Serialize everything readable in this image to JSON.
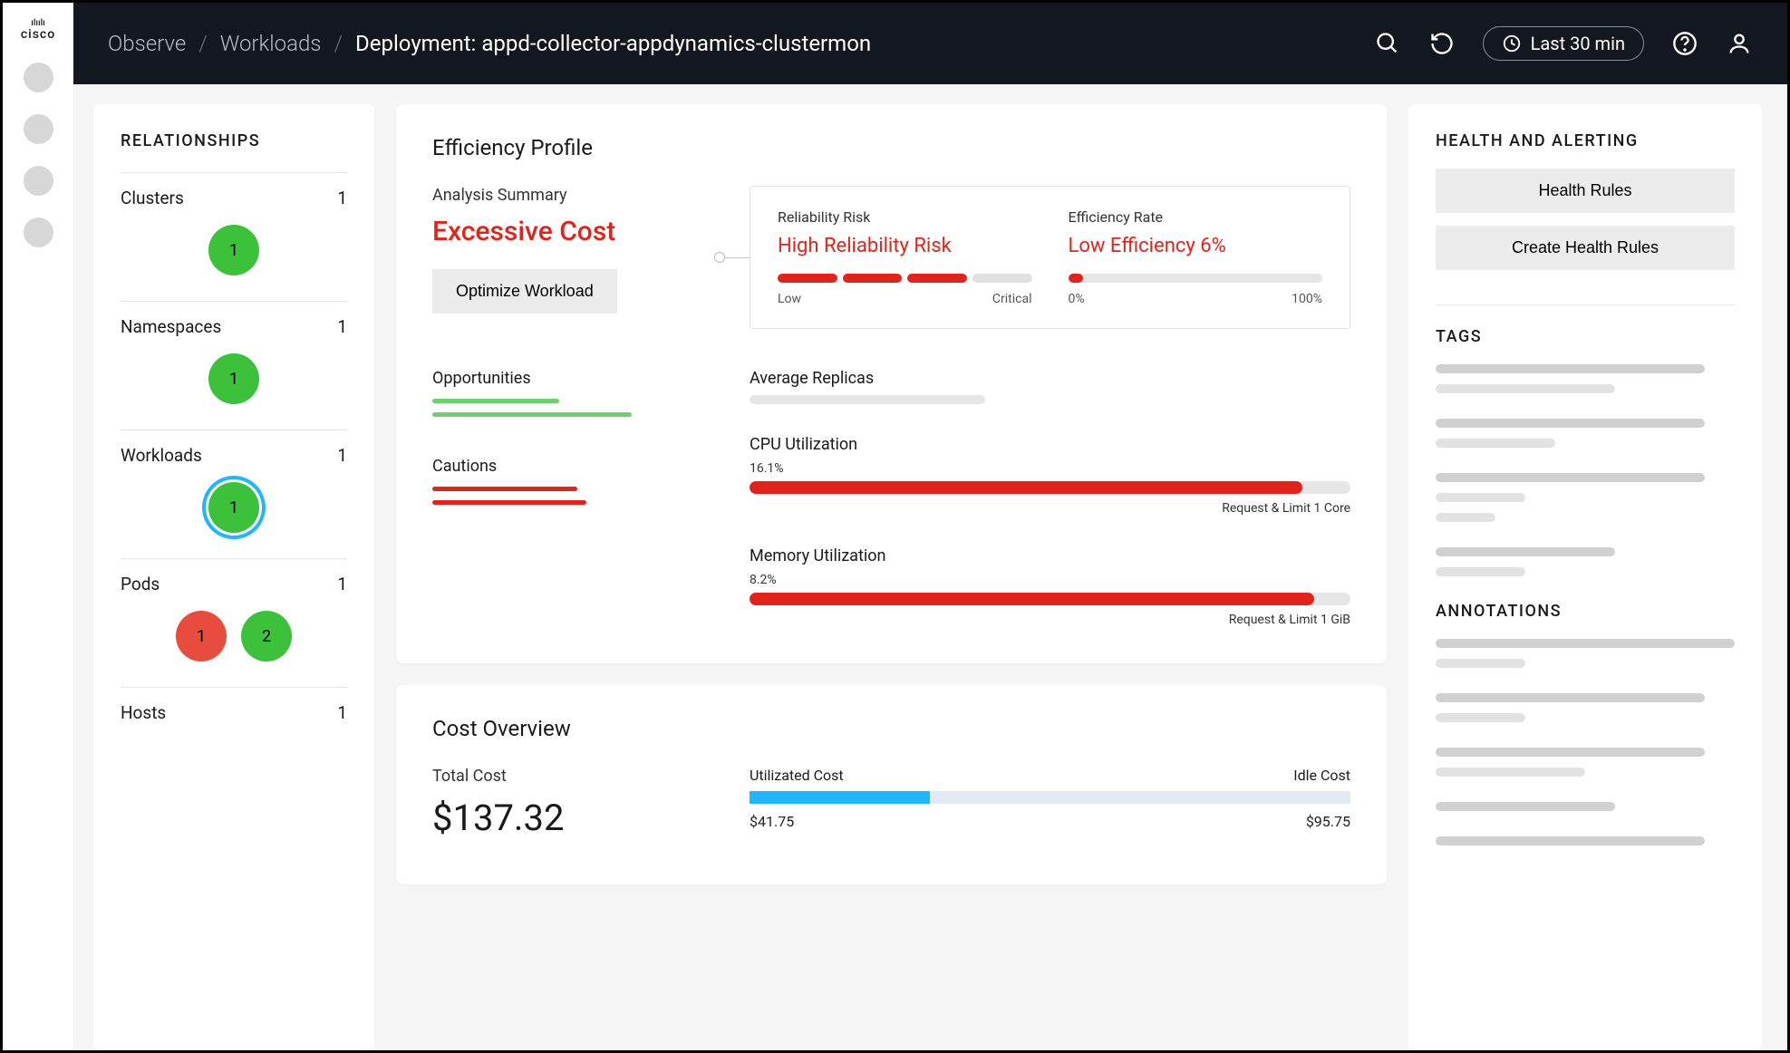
{
  "brand": {
    "name": "cisco"
  },
  "breadcrumb": {
    "items": [
      "Observe",
      "Workloads"
    ],
    "current": "Deployment: appd-collector-appdynamics-clustermon"
  },
  "topbar": {
    "time_range": "Last 30 min"
  },
  "relationships": {
    "title": "RELATIONSHIPS",
    "sections": [
      {
        "label": "Clusters",
        "count": "1",
        "bubbles": [
          {
            "value": "1",
            "color": "green",
            "ring": false
          }
        ]
      },
      {
        "label": "Namespaces",
        "count": "1",
        "bubbles": [
          {
            "value": "1",
            "color": "green",
            "ring": false
          }
        ]
      },
      {
        "label": "Workloads",
        "count": "1",
        "bubbles": [
          {
            "value": "1",
            "color": "green",
            "ring": true
          }
        ]
      },
      {
        "label": "Pods",
        "count": "1",
        "bubbles": [
          {
            "value": "1",
            "color": "red",
            "ring": false
          },
          {
            "value": "2",
            "color": "green",
            "ring": false
          }
        ]
      },
      {
        "label": "Hosts",
        "count": "1",
        "bubbles": []
      }
    ]
  },
  "efficiency": {
    "title": "Efficiency Profile",
    "analysis_label": "Analysis Summary",
    "analysis_value": "Excessive Cost",
    "optimize_label": "Optimize Workload",
    "reliability": {
      "title": "Reliability Risk",
      "value": "High Reliability Risk",
      "low_label": "Low",
      "high_label": "Critical",
      "filled_ticks": 3,
      "total_ticks": 4
    },
    "efficiency_rate": {
      "title": "Efficiency Rate",
      "value": "Low Efficiency 6%",
      "low_label": "0%",
      "high_label": "100%",
      "percent": 6
    },
    "opportunities_label": "Opportunities",
    "cautions_label": "Cautions",
    "avg_replicas_label": "Average Replicas",
    "cpu": {
      "title": "CPU Utilization",
      "percent_label": "16.1%",
      "percent": 92,
      "caption": "Request & Limit 1 Core"
    },
    "memory": {
      "title": "Memory Utilization",
      "percent_label": "8.2%",
      "percent": 94,
      "caption": "Request & Limit 1 GiB"
    }
  },
  "cost": {
    "title": "Cost Overview",
    "total_label": "Total Cost",
    "total_value": "$137.32",
    "util_label": "Utilizated Cost",
    "idle_label": "Idle Cost",
    "util_value": "$41.75",
    "idle_value": "$95.75",
    "util_percent": 30
  },
  "right": {
    "health_title": "HEALTH AND ALERTING",
    "health_rules_label": "Health Rules",
    "create_health_label": "Create Health Rules",
    "tags_title": "TAGS",
    "annotations_title": "ANNOTATIONS"
  },
  "chart_data": [
    {
      "type": "bar",
      "title": "Reliability Risk",
      "categories": [
        "Low",
        "",
        "",
        "Critical"
      ],
      "values": [
        1,
        1,
        1,
        0
      ],
      "note": "segmented risk indicator, 3 of 4 segments filled (High Reliability Risk)"
    },
    {
      "type": "bar",
      "title": "Efficiency Rate",
      "xlabel": "",
      "ylabel": "",
      "categories": [
        "Efficiency"
      ],
      "values": [
        6
      ],
      "ylim": [
        0,
        100
      ],
      "unit": "%"
    },
    {
      "type": "bar",
      "title": "CPU Utilization",
      "categories": [
        "CPU"
      ],
      "values": [
        16.1
      ],
      "ylim": [
        0,
        100
      ],
      "unit": "%",
      "annotation": "Request & Limit 1 Core"
    },
    {
      "type": "bar",
      "title": "Memory Utilization",
      "categories": [
        "Memory"
      ],
      "values": [
        8.2
      ],
      "ylim": [
        0,
        100
      ],
      "unit": "%",
      "annotation": "Request & Limit 1 GiB"
    },
    {
      "type": "bar",
      "title": "Cost Overview",
      "categories": [
        "Utilizated Cost",
        "Idle Cost"
      ],
      "values": [
        41.75,
        95.75
      ],
      "unit": "$",
      "total": 137.32
    }
  ]
}
